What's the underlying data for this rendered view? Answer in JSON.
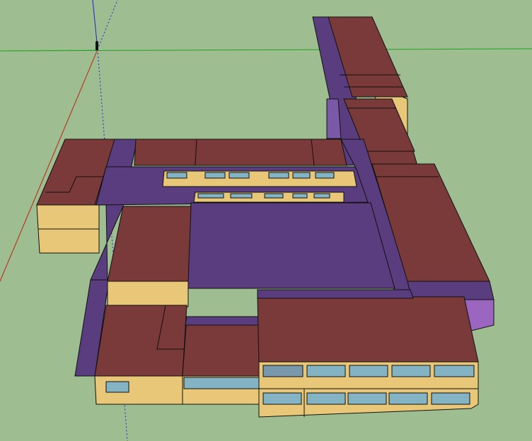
{
  "scene": {
    "type": "3d-model-viewport",
    "background": "#9ebe92",
    "axes": {
      "red": "#c02010",
      "green": "#20a020",
      "blue": "#2020d0"
    },
    "colors": {
      "roof": "#7b3a3a",
      "connector_roof": "#5a3d7e",
      "wall": "#e8c878",
      "window": "#84b4c4",
      "edge": "#101010"
    },
    "icons": [
      "origin-person-icon"
    ]
  }
}
